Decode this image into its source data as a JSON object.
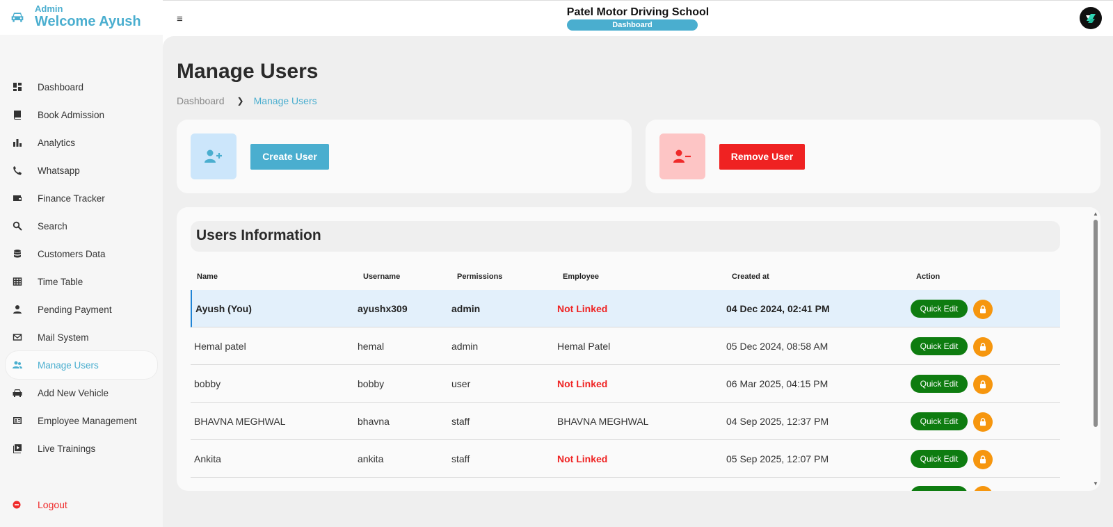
{
  "brand": {
    "role": "Admin",
    "welcome": "Welcome Ayush"
  },
  "topbar": {
    "title": "Patel Motor Driving School",
    "badge": "Dashboard"
  },
  "sidebar": {
    "items": [
      {
        "label": "Dashboard",
        "icon": "dashboard-icon"
      },
      {
        "label": "Book Admission",
        "icon": "book-icon"
      },
      {
        "label": "Analytics",
        "icon": "bar-chart-icon"
      },
      {
        "label": "Whatsapp",
        "icon": "phone-icon"
      },
      {
        "label": "Finance Tracker",
        "icon": "wallet-icon"
      },
      {
        "label": "Search",
        "icon": "search-icon"
      },
      {
        "label": "Customers Data",
        "icon": "database-icon"
      },
      {
        "label": "Time Table",
        "icon": "table-icon"
      },
      {
        "label": "Pending Payment",
        "icon": "person-icon"
      },
      {
        "label": "Mail System",
        "icon": "mail-icon"
      },
      {
        "label": "Manage Users",
        "icon": "users-icon",
        "active": true
      },
      {
        "label": "Add New Vehicle",
        "icon": "car-icon"
      },
      {
        "label": "Employee Management",
        "icon": "id-card-icon"
      },
      {
        "label": "Live Trainings",
        "icon": "video-library-icon"
      }
    ],
    "logout": "Logout"
  },
  "page": {
    "title": "Manage Users",
    "breadcrumb": [
      "Dashboard",
      "Manage Users"
    ]
  },
  "actions": {
    "create": "Create User",
    "remove": "Remove User"
  },
  "table": {
    "title": "Users Information",
    "columns": [
      "Name",
      "Username",
      "Permissions",
      "Employee",
      "Created at",
      "Action"
    ],
    "quick_edit": "Quick Edit",
    "rows": [
      {
        "name": "Ayush (You)",
        "username": "ayushx309",
        "permissions": "admin",
        "employee": "Not Linked",
        "created": "04 Dec 2024, 02:41 PM"
      },
      {
        "name": "Hemal patel",
        "username": "hemal",
        "permissions": "admin",
        "employee": "Hemal Patel",
        "created": "05 Dec 2024, 08:58 AM"
      },
      {
        "name": "bobby",
        "username": "bobby",
        "permissions": "user",
        "employee": "Not Linked",
        "created": "06 Mar 2025, 04:15 PM"
      },
      {
        "name": "BHAVNA MEGHWAL",
        "username": "bhavna",
        "permissions": "staff",
        "employee": "BHAVNA MEGHWAL",
        "created": "04 Sep 2025, 12:37 PM"
      },
      {
        "name": "Ankita",
        "username": "ankita",
        "permissions": "staff",
        "employee": "Not Linked",
        "created": "05 Sep 2025, 12:07 PM"
      }
    ]
  },
  "colors": {
    "accent": "#4aaecf",
    "danger": "#ef2222",
    "success": "#0e7c10",
    "warning": "#f6960e"
  }
}
